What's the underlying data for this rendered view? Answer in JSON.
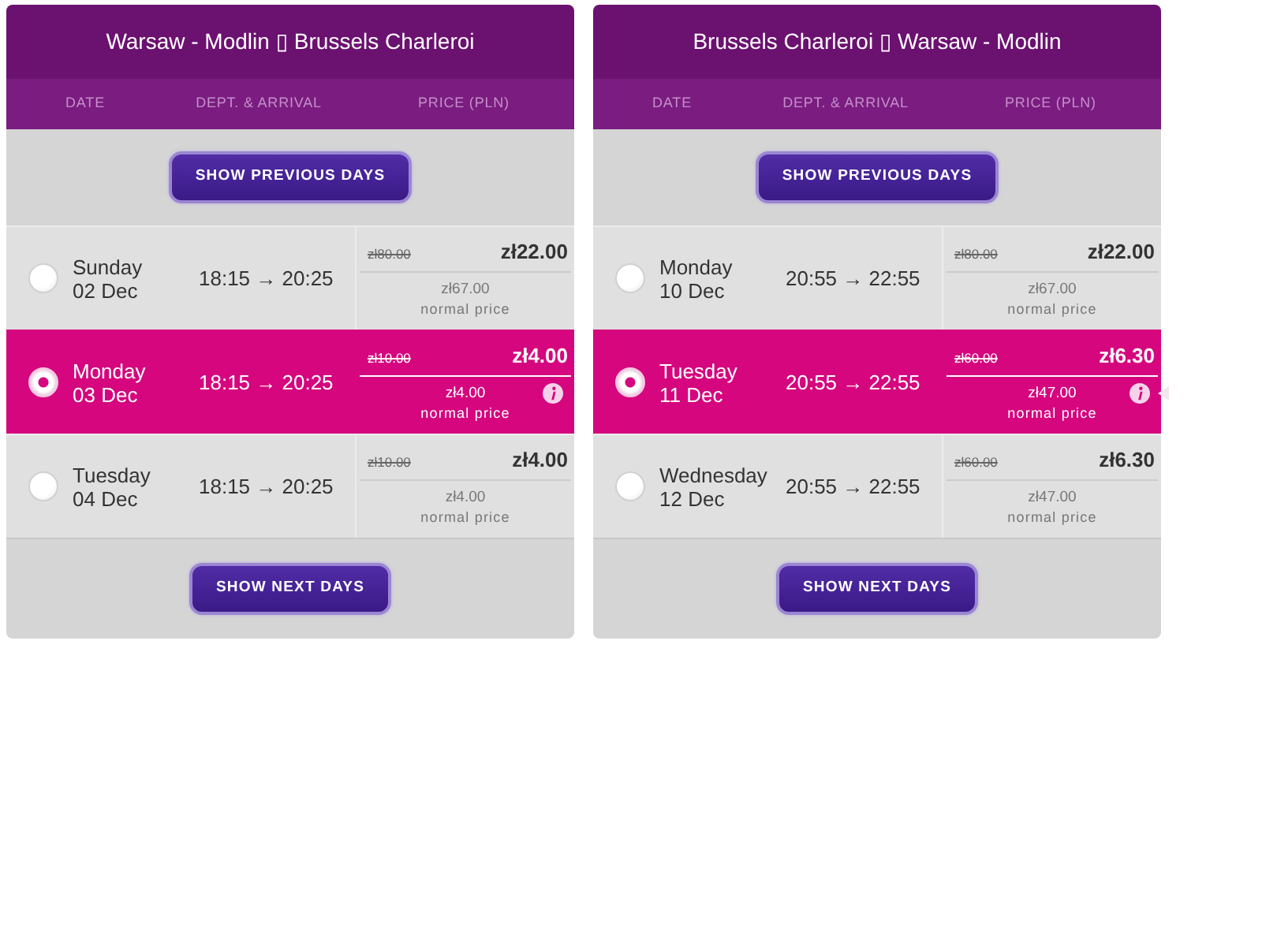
{
  "flights": [
    {
      "title": "Warsaw - Modlin ▯ Brussels Charleroi",
      "columns": [
        "DATE",
        "DEPT. & ARRIVAL",
        "PRICE (PLN)"
      ],
      "previous_button": "SHOW PREVIOUS DAYS",
      "tooltip_pointer": false,
      "days": [
        {
          "day": "Sunday",
          "date": "02 Dec",
          "time": "18:15 → 20:25",
          "old_price": "zł80.00",
          "price": "zł22.00",
          "normal_price": "zł67.00",
          "normal_label": "normal price",
          "selected": false
        },
        {
          "day": "Monday",
          "date": "03 Dec",
          "time": "18:15 → 20:25",
          "old_price": "zł10.00",
          "price": "zł4.00",
          "normal_price": "zł4.00",
          "normal_label": "normal price",
          "selected": true
        },
        {
          "day": "Tuesday",
          "date": "04 Dec",
          "time": "18:15 → 20:25",
          "old_price": "zł10.00",
          "price": "zł4.00",
          "normal_price": "zł4.00",
          "normal_label": "normal price",
          "selected": false
        }
      ],
      "next_button": "SHOW NEXT DAYS"
    },
    {
      "title": "Brussels Charleroi ▯ Warsaw - Modlin",
      "columns": [
        "DATE",
        "DEPT. & ARRIVAL",
        "PRICE (PLN)"
      ],
      "previous_button": "SHOW PREVIOUS DAYS",
      "tooltip_pointer": true,
      "days": [
        {
          "day": "Monday",
          "date": "10 Dec",
          "time": "20:55 → 22:55",
          "old_price": "zł80.00",
          "price": "zł22.00",
          "normal_price": "zł67.00",
          "normal_label": "normal price",
          "selected": false
        },
        {
          "day": "Tuesday",
          "date": "11 Dec",
          "time": "20:55 → 22:55",
          "old_price": "zł60.00",
          "price": "zł6.30",
          "normal_price": "zł47.00",
          "normal_label": "normal price",
          "selected": true
        },
        {
          "day": "Wednesday",
          "date": "12 Dec",
          "time": "20:55 → 22:55",
          "old_price": "zł60.00",
          "price": "zł6.30",
          "normal_price": "zł47.00",
          "normal_label": "normal price",
          "selected": false
        }
      ],
      "next_button": "SHOW NEXT DAYS"
    }
  ]
}
